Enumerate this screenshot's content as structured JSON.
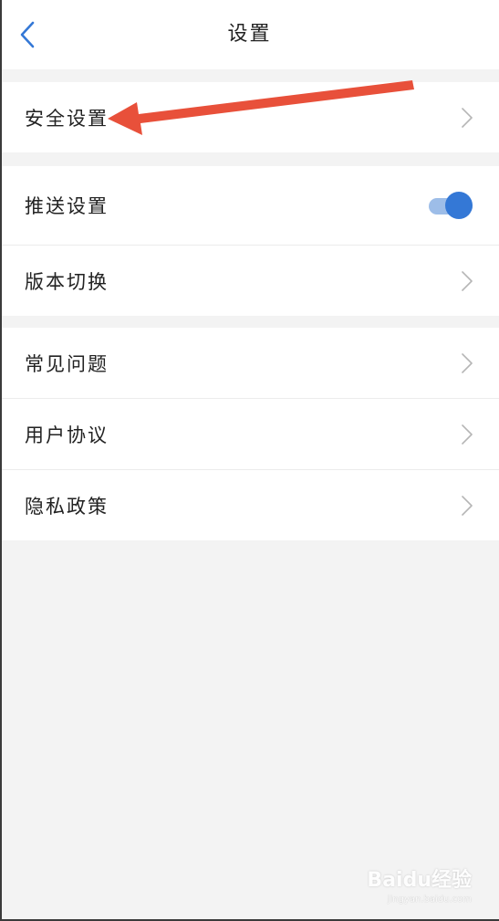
{
  "header": {
    "title": "设置",
    "back_icon": "chevron-left-icon"
  },
  "groups": [
    {
      "items": [
        {
          "label": "安全设置",
          "trailing": "chevron-right-icon"
        }
      ]
    },
    {
      "items": [
        {
          "label": "推送设置",
          "trailing": "toggle",
          "toggle_on": true
        },
        {
          "label": "版本切换",
          "trailing": "chevron-right-icon"
        }
      ]
    },
    {
      "items": [
        {
          "label": "常见问题",
          "trailing": "chevron-right-icon"
        },
        {
          "label": "用户协议",
          "trailing": "chevron-right-icon"
        },
        {
          "label": "隐私政策",
          "trailing": "chevron-right-icon"
        }
      ]
    }
  ],
  "annotation": {
    "type": "red-arrow",
    "points_to": "安全设置",
    "color": "#e8503a"
  },
  "watermark": {
    "brand_text": "Baidu经验",
    "url_text": "jingyan.baidu.com"
  },
  "colors": {
    "accent": "#3478d6",
    "toggle_track": "#9dbde8",
    "page_bg": "#f3f3f3"
  }
}
